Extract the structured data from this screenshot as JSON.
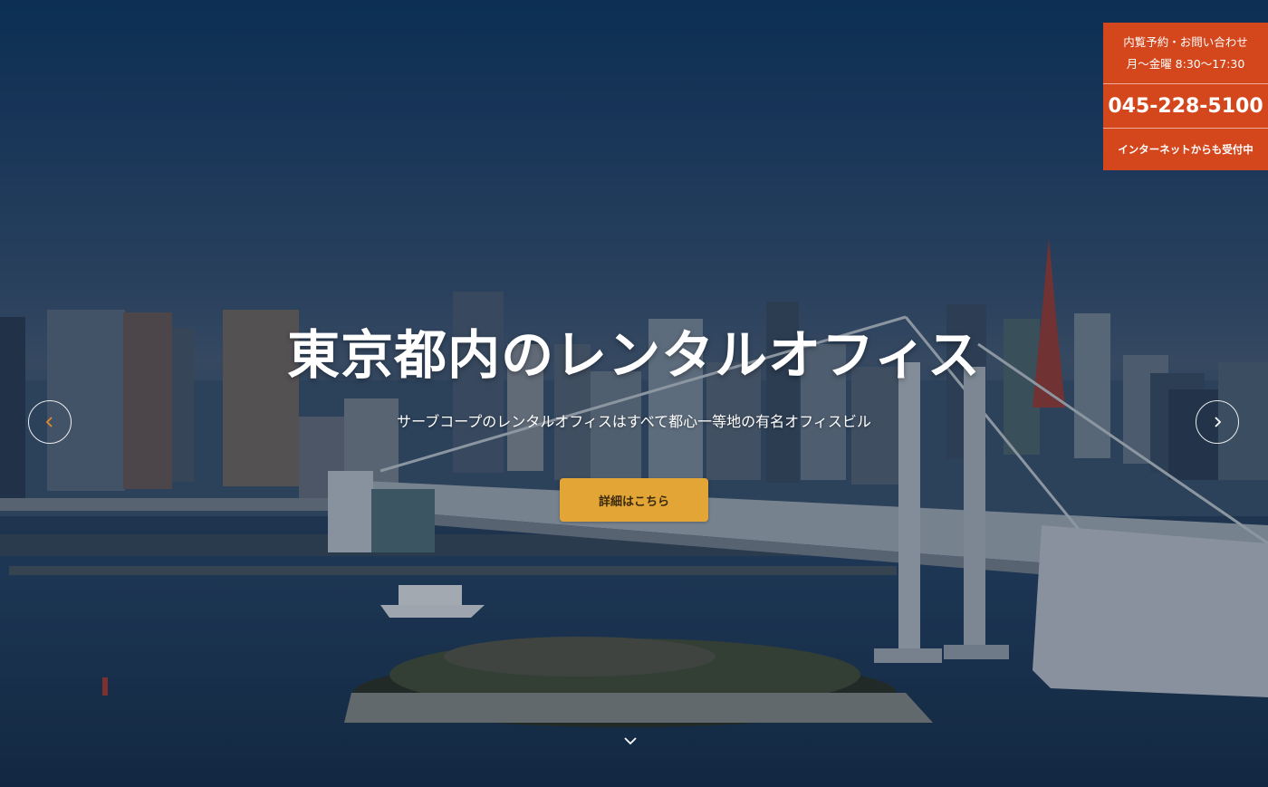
{
  "hero": {
    "title": "東京都内のレンタルオフィス",
    "subtitle": "サーブコープのレンタルオフィスはすべて都心一等地の有名オフィスビル",
    "cta_label": "詳細はこちら"
  },
  "contact": {
    "line1": "内覧予約・お問い合わせ",
    "line2": "月〜金曜 8:30〜17:30",
    "phone": "045-228-5100",
    "online": "インターネットからも受付中"
  },
  "icons": {
    "prev": "chevron-left-icon",
    "next": "chevron-right-icon",
    "scroll": "chevron-down-icon"
  },
  "colors": {
    "contact_bg": "#d4471d",
    "cta_bg": "#e3a535",
    "prev_arrow": "#e08a2a"
  }
}
